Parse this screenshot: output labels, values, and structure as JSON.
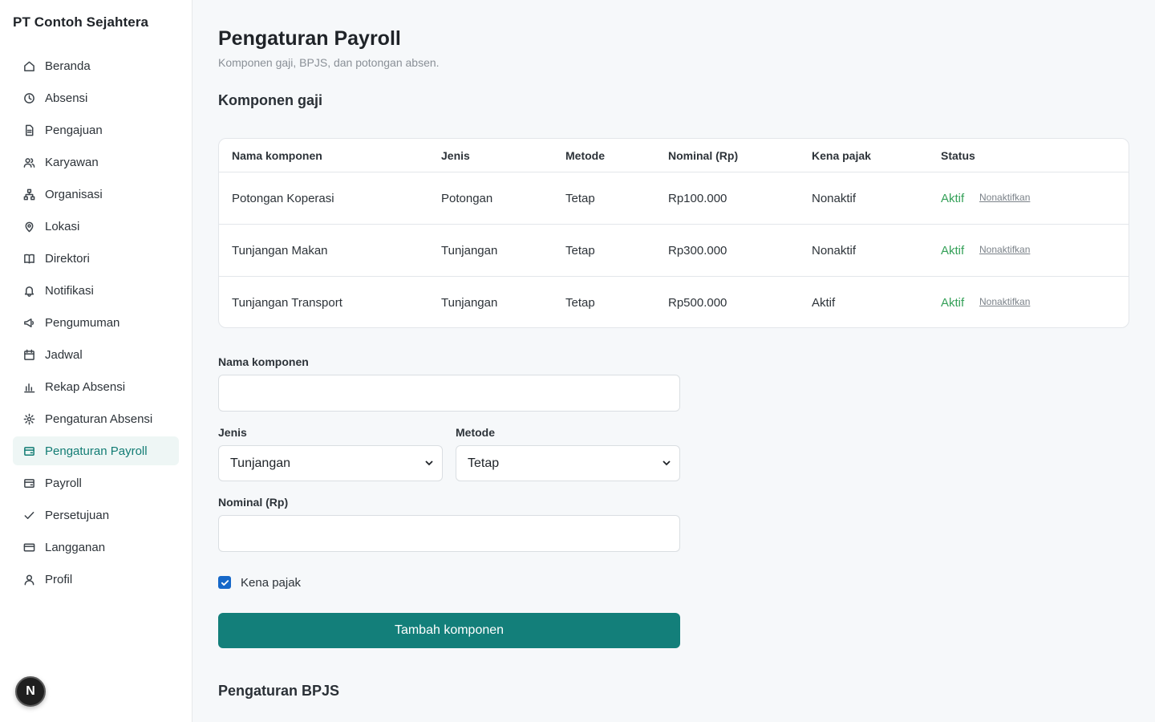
{
  "app": {
    "company": "PT Contoh Sejahtera",
    "avatar_letter": "N"
  },
  "sidebar": {
    "items": [
      {
        "label": "Beranda",
        "icon": "home-icon"
      },
      {
        "label": "Absensi",
        "icon": "clock-icon"
      },
      {
        "label": "Pengajuan",
        "icon": "document-icon"
      },
      {
        "label": "Karyawan",
        "icon": "users-icon"
      },
      {
        "label": "Organisasi",
        "icon": "org-chart-icon"
      },
      {
        "label": "Lokasi",
        "icon": "map-pin-icon"
      },
      {
        "label": "Direktori",
        "icon": "book-icon"
      },
      {
        "label": "Notifikasi",
        "icon": "bell-icon"
      },
      {
        "label": "Pengumuman",
        "icon": "megaphone-icon"
      },
      {
        "label": "Jadwal",
        "icon": "calendar-icon"
      },
      {
        "label": "Rekap Absensi",
        "icon": "bar-chart-icon"
      },
      {
        "label": "Pengaturan Absensi",
        "icon": "gear-icon"
      },
      {
        "label": "Pengaturan Payroll",
        "icon": "wallet-icon",
        "active": true
      },
      {
        "label": "Payroll",
        "icon": "wallet-icon"
      },
      {
        "label": "Persetujuan",
        "icon": "check-icon"
      },
      {
        "label": "Langganan",
        "icon": "credit-card-icon"
      },
      {
        "label": "Profil",
        "icon": "user-icon"
      }
    ]
  },
  "page": {
    "title": "Pengaturan Payroll",
    "subtitle": "Komponen gaji, BPJS, dan potongan absen."
  },
  "components": {
    "section_title": "Komponen gaji",
    "columns": [
      "Nama komponen",
      "Jenis",
      "Metode",
      "Nominal (Rp)",
      "Kena pajak",
      "Status"
    ],
    "rows": [
      {
        "name": "Potongan Koperasi",
        "type": "Potongan",
        "method": "Tetap",
        "amount": "Rp100.000",
        "taxable": "Nonaktif",
        "status": "Aktif",
        "action": "Nonaktifkan"
      },
      {
        "name": "Tunjangan Makan",
        "type": "Tunjangan",
        "method": "Tetap",
        "amount": "Rp300.000",
        "taxable": "Nonaktif",
        "status": "Aktif",
        "action": "Nonaktifkan"
      },
      {
        "name": "Tunjangan Transport",
        "type": "Tunjangan",
        "method": "Tetap",
        "amount": "Rp500.000",
        "taxable": "Aktif",
        "status": "Aktif",
        "action": "Nonaktifkan"
      }
    ]
  },
  "form": {
    "name_label": "Nama komponen",
    "name_value": "",
    "type_label": "Jenis",
    "type_value": "Tunjangan",
    "method_label": "Metode",
    "method_value": "Tetap",
    "amount_label": "Nominal (Rp)",
    "amount_value": "",
    "taxable_label": "Kena pajak",
    "taxable_checked": true,
    "submit_label": "Tambah komponen"
  },
  "bpjs": {
    "section_title": "Pengaturan BPJS"
  },
  "colors": {
    "accent": "#137f7a",
    "status_active": "#34a058",
    "checkbox": "#1668c9"
  }
}
